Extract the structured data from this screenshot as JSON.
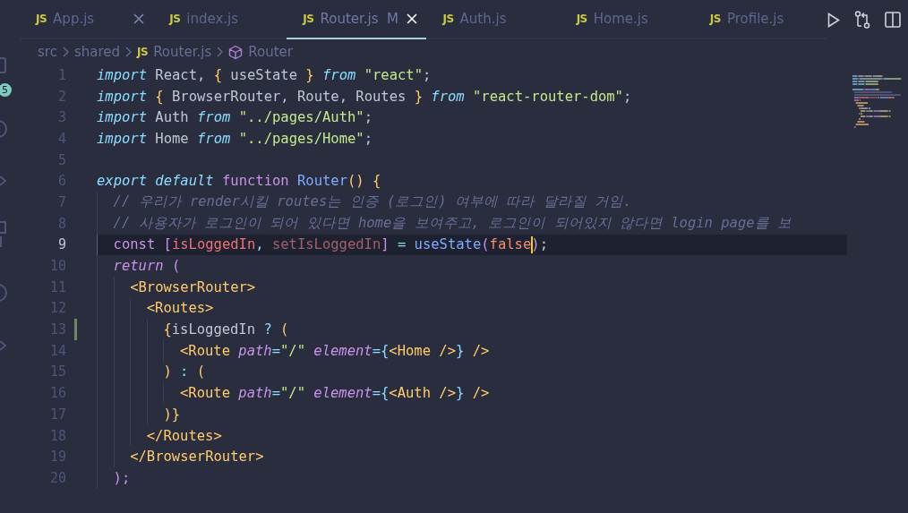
{
  "activity_bar": {
    "badge": "5"
  },
  "tabs": [
    {
      "file_icon": "JS",
      "label": "App.js",
      "selected": false,
      "close_visible": true
    },
    {
      "file_icon": "JS",
      "label": "index.js",
      "selected": false,
      "close_visible": false
    },
    {
      "file_icon": "JS",
      "label": "Router.js",
      "status": "M",
      "selected": true,
      "close_visible": true
    },
    {
      "file_icon": "JS",
      "label": "Auth.js",
      "selected": false,
      "close_visible": false
    },
    {
      "file_icon": "JS",
      "label": "Home.js",
      "selected": false,
      "close_visible": false
    },
    {
      "file_icon": "JS",
      "label": "Profile.js",
      "selected": false,
      "close_visible": false
    }
  ],
  "breadcrumbs": [
    {
      "kind": "folder",
      "label": "src"
    },
    {
      "kind": "folder",
      "label": "shared"
    },
    {
      "kind": "file",
      "file_icon": "JS",
      "label": "Router.js"
    },
    {
      "kind": "symbol",
      "label": "Router"
    }
  ],
  "lines": [
    {
      "number": "1",
      "tokens": [
        {
          "t": "import",
          "kind": "kwi"
        },
        {
          "t": " React, ",
          "kind": "plain"
        },
        {
          "t": "{",
          "kind": "brace"
        },
        {
          "t": " useState ",
          "kind": "plain"
        },
        {
          "t": "}",
          "kind": "brace"
        },
        {
          "t": " from ",
          "kind": "kwi"
        },
        {
          "t": "\"react\"",
          "kind": "str"
        },
        {
          "t": ";",
          "kind": "plain"
        }
      ]
    },
    {
      "number": "2",
      "tokens": [
        {
          "t": "import ",
          "kind": "kwi"
        },
        {
          "t": "{",
          "kind": "brace"
        },
        {
          "t": " BrowserRouter, Route, Routes ",
          "kind": "plain"
        },
        {
          "t": "}",
          "kind": "brace"
        },
        {
          "t": " from ",
          "kind": "kwi"
        },
        {
          "t": "\"react-router-dom\"",
          "kind": "str"
        },
        {
          "t": ";",
          "kind": "plain"
        }
      ]
    },
    {
      "number": "3",
      "tokens": [
        {
          "t": "import",
          "kind": "kwi"
        },
        {
          "t": " Auth ",
          "kind": "plain"
        },
        {
          "t": "from",
          "kind": "kwi"
        },
        {
          "t": " \"../pages/Auth\"",
          "kind": "str"
        },
        {
          "t": ";",
          "kind": "plain"
        }
      ]
    },
    {
      "number": "4",
      "tokens": [
        {
          "t": "import",
          "kind": "kwi"
        },
        {
          "t": " Home ",
          "kind": "plain"
        },
        {
          "t": "from",
          "kind": "kwi"
        },
        {
          "t": " \"../pages/Home\"",
          "kind": "str"
        },
        {
          "t": ";",
          "kind": "plain"
        }
      ]
    },
    {
      "number": "5"
    },
    {
      "number": "6",
      "tokens": [
        {
          "t": "export default",
          "kind": "kwi"
        },
        {
          "t": " function ",
          "kind": "storage"
        },
        {
          "t": "Router",
          "kind": "func"
        },
        {
          "t": "() {",
          "kind": "brace"
        }
      ]
    },
    {
      "number": "7",
      "tokens": [
        {
          "t": "  // 우리가 render시킬 routes는 인증 (로그인) 여부에 따라 달라질 거임.",
          "kind": "comment"
        }
      ]
    },
    {
      "number": "8",
      "tokens": [
        {
          "t": "  // 사용자가 로그인이 되어 있다면 home을 보여주고, 로그인이 되어있지 않다면 login page를 보",
          "kind": "comment"
        }
      ]
    },
    {
      "number": "9",
      "current": true,
      "tokens": [
        {
          "t": "  const ",
          "kind": "storage"
        },
        {
          "t": "[",
          "kind": "bracket"
        },
        {
          "t": "isLoggedIn",
          "kind": "var"
        },
        {
          "t": ", ",
          "kind": "op"
        },
        {
          "t": "setIsLoggedIn",
          "kind": "var_dim"
        },
        {
          "t": "]",
          "kind": "bracket"
        },
        {
          "t": " = ",
          "kind": "op"
        },
        {
          "t": "useState",
          "kind": "func"
        },
        {
          "t": "(",
          "kind": "bracket"
        },
        {
          "t": "false",
          "kind": "bool",
          "caret": true
        },
        {
          "t": ")",
          "kind": "bracket"
        },
        {
          "t": ";",
          "kind": "plain"
        }
      ]
    },
    {
      "number": "10",
      "tokens": [
        {
          "t": "  return",
          "kind": "control"
        },
        {
          "t": " (",
          "kind": "bracket"
        }
      ]
    },
    {
      "number": "11",
      "tokens": [
        {
          "t": "    <BrowserRouter>",
          "kind": "tag"
        }
      ]
    },
    {
      "number": "12",
      "tokens": [
        {
          "t": "      <Routes>",
          "kind": "tag"
        }
      ]
    },
    {
      "number": "13",
      "changed": true,
      "tokens": [
        {
          "t": "        {",
          "kind": "brace"
        },
        {
          "t": "isLoggedIn",
          "kind": "plain"
        },
        {
          "t": " ? ",
          "kind": "op"
        },
        {
          "t": "(",
          "kind": "brace"
        }
      ]
    },
    {
      "number": "14",
      "tokens": [
        {
          "t": "          <Route",
          "kind": "tag"
        },
        {
          "t": " path",
          "kind": "attr"
        },
        {
          "t": "=",
          "kind": "op"
        },
        {
          "t": "\"/\"",
          "kind": "str"
        },
        {
          "t": " element",
          "kind": "attr"
        },
        {
          "t": "={",
          "kind": "op"
        },
        {
          "t": "<Home />",
          "kind": "tag"
        },
        {
          "t": "}",
          "kind": "op"
        },
        {
          "t": " />",
          "kind": "tag"
        }
      ]
    },
    {
      "number": "15",
      "tokens": [
        {
          "t": "        )",
          "kind": "brace"
        },
        {
          "t": " : ",
          "kind": "op"
        },
        {
          "t": "(",
          "kind": "brace"
        }
      ]
    },
    {
      "number": "16",
      "tokens": [
        {
          "t": "          <Route",
          "kind": "tag"
        },
        {
          "t": " path",
          "kind": "attr"
        },
        {
          "t": "=",
          "kind": "op"
        },
        {
          "t": "\"/\"",
          "kind": "str"
        },
        {
          "t": " element",
          "kind": "attr"
        },
        {
          "t": "={",
          "kind": "op"
        },
        {
          "t": "<Auth />",
          "kind": "tag"
        },
        {
          "t": "}",
          "kind": "op"
        },
        {
          "t": " />",
          "kind": "tag"
        }
      ]
    },
    {
      "number": "17",
      "tokens": [
        {
          "t": "        )}",
          "kind": "brace"
        }
      ]
    },
    {
      "number": "18",
      "tokens": [
        {
          "t": "      </Routes>",
          "kind": "tag"
        }
      ]
    },
    {
      "number": "19",
      "tokens": [
        {
          "t": "    </BrowserRouter>",
          "kind": "tag"
        }
      ]
    },
    {
      "number": "20",
      "tokens": [
        {
          "t": "  );",
          "kind": "bracket"
        }
      ]
    }
  ]
}
